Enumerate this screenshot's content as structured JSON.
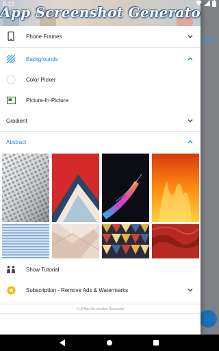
{
  "status_bar": {
    "time": "6:15"
  },
  "header": {
    "title": "App Screenshot Generator"
  },
  "menu": {
    "phone_frames": {
      "label": "Phone Frames",
      "icon": "phone-icon"
    },
    "backgrounds": {
      "label": "Backgrounds",
      "icon": "pattern-icon",
      "expanded": true
    },
    "color_picker": {
      "label": "Color Picker",
      "icon": "circle-icon"
    },
    "picture_in_picture": {
      "label": "Picture-In-Picture",
      "icon": "pip-icon"
    },
    "gradient": {
      "label": "Gradient",
      "expanded": false
    },
    "abstract": {
      "label": "Abstract",
      "expanded": true
    },
    "show_tutorial": {
      "label": "Show Tutorial",
      "icon": "people-icon"
    },
    "subscription": {
      "label": "Subscription - Remove Ads & Watermarks",
      "icon": "star-badge-icon"
    }
  },
  "abstract_thumbnails": [
    {
      "name": "honeycomb-facade"
    },
    {
      "name": "red-paper-layers"
    },
    {
      "name": "neon-light-streak"
    },
    {
      "name": "orange-flames"
    },
    {
      "name": "blue-stripes"
    },
    {
      "name": "paper-envelopes"
    },
    {
      "name": "geometric-pyramids"
    },
    {
      "name": "red-fabric"
    }
  ],
  "footer": {
    "version": "v1.8 App Screenshot Generator"
  },
  "colors": {
    "accent": "#1e88e5",
    "header_stroke": "#1c4f80",
    "pip_icon": "#2e7d32",
    "star_badge": "#f5b800"
  }
}
